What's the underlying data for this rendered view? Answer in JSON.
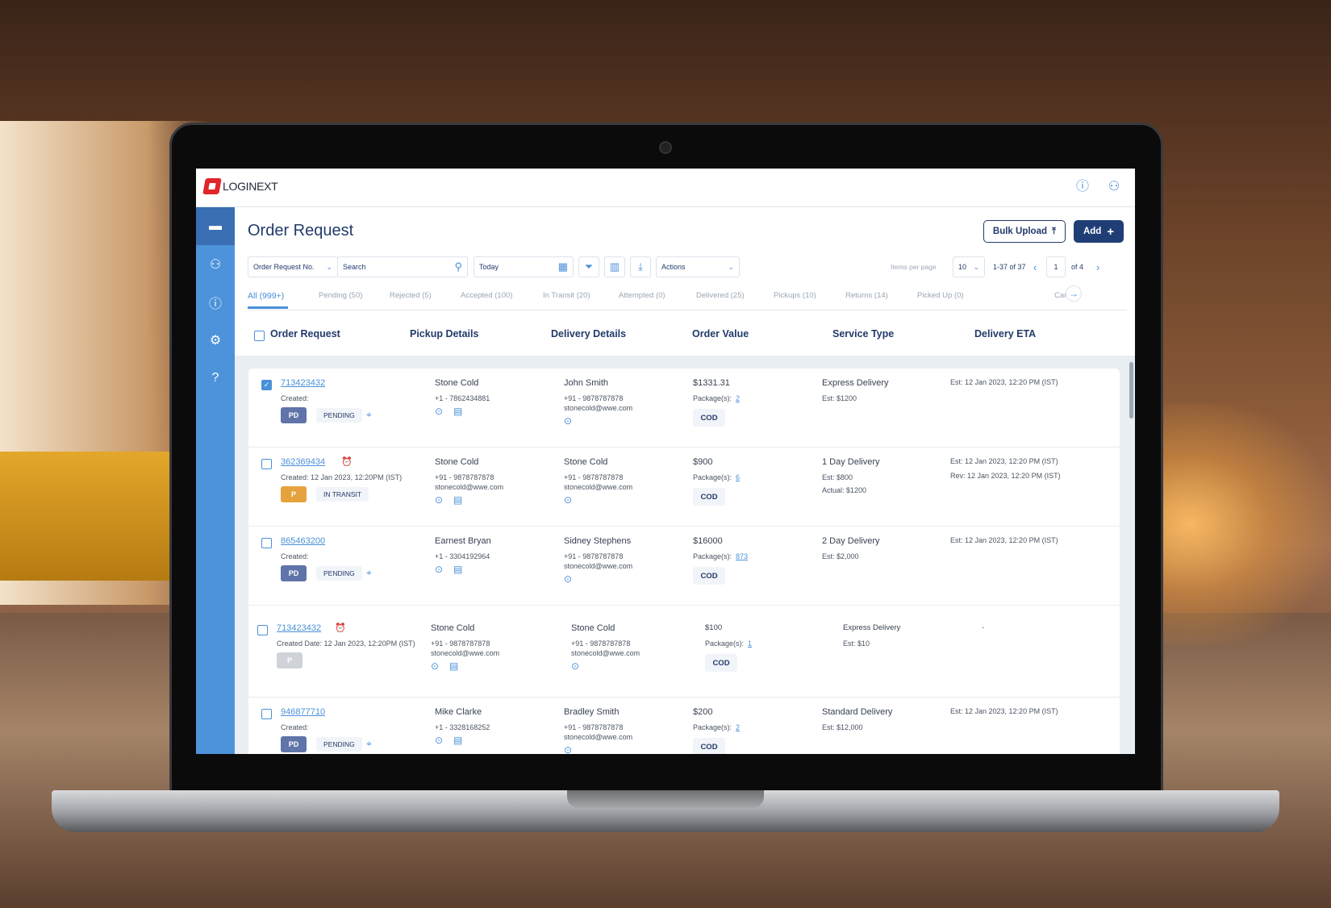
{
  "app": {
    "brand": "LOGINEXT",
    "help_icon": "help-circle-icon",
    "user_icon": "user-icon"
  },
  "sidebar": {
    "items": [
      {
        "icon": "archive-icon",
        "glyph": "▬",
        "active": true
      },
      {
        "icon": "user-icon",
        "glyph": "⚇"
      },
      {
        "icon": "alert-icon",
        "glyph": "ⓘ"
      },
      {
        "icon": "gear-icon",
        "glyph": "⚙"
      },
      {
        "icon": "help-icon",
        "glyph": "?"
      }
    ]
  },
  "page": {
    "title": "Order Request",
    "bulk_upload": "Bulk Upload",
    "add": "Add"
  },
  "toolbar": {
    "search_by": "Order Request No.",
    "search_placeholder": "Search",
    "date": "Today",
    "actions": "Actions",
    "items_per_page_label": "Items per page",
    "items_per_page": "10",
    "range": "1-37 of 37",
    "page": "1",
    "of_pages": "of 4"
  },
  "tabs": [
    {
      "label": "All (999+)",
      "active": true
    },
    {
      "label": "Pending (50)"
    },
    {
      "label": "Rejected (5)"
    },
    {
      "label": "Accepted (100)"
    },
    {
      "label": "In Transit (20)"
    },
    {
      "label": "Attempted (0)"
    },
    {
      "label": "Delivered (25)"
    },
    {
      "label": "Pickups (10)"
    },
    {
      "label": "Returns (14)"
    },
    {
      "label": "Picked Up (0)"
    },
    {
      "label": "Can     d ("
    }
  ],
  "columns": [
    "Order Request",
    "Pickup Details",
    "Delivery Details",
    "Order Value",
    "Service Type",
    "Delivery ETA"
  ],
  "colors": {
    "accent": "#4a90d9",
    "navy": "#1f3e75",
    "pd_badge": "#5f74a8",
    "p_badge": "#e6a23c",
    "p_disabled": "#cfd3d8",
    "alarm": "#5cb85c"
  },
  "rows": [
    {
      "checked": true,
      "id": "713423432",
      "alarm": false,
      "created": "Created:",
      "badge": "PD",
      "badge_color": "#5f74a8",
      "status": "PENDING",
      "locate": true,
      "pickup": {
        "name": "Stone Cold",
        "phone": "+1 - 7862434881",
        "email": ""
      },
      "delivery": {
        "name": "John Smith",
        "phone": "+91 - 9878787878",
        "email": "stonecold@wwe.com"
      },
      "value": "$1331.31",
      "packages_label": "Package(s):",
      "packages": "2",
      "payment": "COD",
      "service": "Express Delivery",
      "est": "Est:  $1200",
      "actual": "",
      "eta": "Est: 12 Jan 2023, 12:20 PM (IST)",
      "rev": ""
    },
    {
      "checked": false,
      "id": "362369434",
      "alarm": true,
      "created": "Created: 12 Jan 2023, 12:20PM (IST)",
      "badge": "P",
      "badge_color": "#e6a23c",
      "status": "IN TRANSIT",
      "locate": false,
      "pickup": {
        "name": "Stone Cold",
        "phone": "+91 - 9878787878",
        "email": "stonecold@wwe.com"
      },
      "delivery": {
        "name": "Stone Cold",
        "phone": "+91 - 9878787878",
        "email": "stonecold@wwe.com"
      },
      "value": "$900",
      "packages_label": "Package(s):",
      "packages": "6",
      "payment": "COD",
      "service": "1 Day Delivery",
      "est": "Est:  $800",
      "actual": "Actual:  $1200",
      "eta": "Est: 12 Jan 2023, 12:20 PM (IST)",
      "rev": "Rev: 12 Jan 2023, 12:20 PM (IST)"
    },
    {
      "checked": false,
      "id": "865463200",
      "alarm": false,
      "created": "Created:",
      "badge": "PD",
      "badge_color": "#5f74a8",
      "status": "PENDING",
      "locate": true,
      "pickup": {
        "name": "Earnest Bryan",
        "phone": "+1 - 3304192964",
        "email": ""
      },
      "delivery": {
        "name": "Sidney Stephens",
        "phone": "+91 - 9878787878",
        "email": "stonecold@wwe.com"
      },
      "value": "$16000",
      "packages_label": "Package(s):",
      "packages": "873",
      "payment": "COD",
      "service": "2 Day Delivery",
      "est": "Est:  $2,000",
      "actual": "",
      "eta": "Est: 12 Jan 2023, 12:20 PM (IST)",
      "rev": ""
    },
    {
      "checked": false,
      "id": "713423432",
      "alarm": true,
      "created": "Created Date: 12 Jan 2023, 12:20PM (IST)",
      "badge": "P",
      "badge_color": "#cfd3d8",
      "status": "",
      "locate": false,
      "pickup": {
        "name": "Stone Cold",
        "phone": "+91 - 9878787878",
        "email": "stonecold@wwe.com"
      },
      "delivery": {
        "name": "Stone Cold",
        "phone": "+91 - 9878787878",
        "email": "stonecold@wwe.com"
      },
      "value": "$100",
      "packages_label": "Package(s):",
      "packages": "1",
      "payment": "COD",
      "service": "Express Delivery",
      "est": "Est:  $10",
      "actual": "",
      "eta": "-",
      "rev": ""
    },
    {
      "checked": false,
      "id": "946877710",
      "alarm": false,
      "created": "Created:",
      "badge": "PD",
      "badge_color": "#5f74a8",
      "status": "PENDING",
      "locate": true,
      "pickup": {
        "name": "Mike Clarke",
        "phone": "+1 - 3328168252",
        "email": ""
      },
      "delivery": {
        "name": "Bradley Smith",
        "phone": "+91 - 9878787878",
        "email": "stonecold@wwe.com"
      },
      "value": "$200",
      "packages_label": "Package(s):",
      "packages": "2",
      "payment": "COD",
      "service": "Standard Delivery",
      "est": "Est:  $12,000",
      "actual": "",
      "eta": "Est: 12 Jan 2023, 12:20 PM (IST)",
      "rev": ""
    }
  ]
}
